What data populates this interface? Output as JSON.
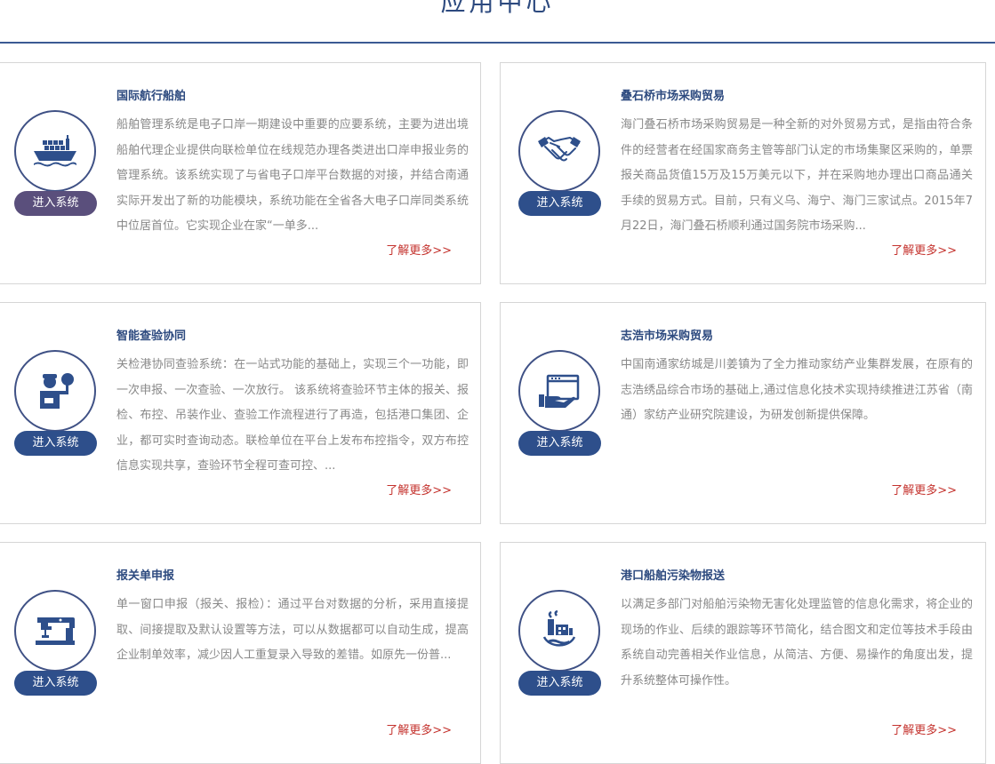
{
  "page": {
    "title": "应用中心"
  },
  "colors": {
    "accent": "#2d4a7f",
    "button_dark": "#5a4f7c",
    "button_blue": "#2e4f8b",
    "more": "#c4322d",
    "text": "#888888"
  },
  "cards": [
    {
      "title": "国际航行船舶",
      "icon": "ship-icon",
      "description": "船舶管理系统是电子口岸一期建设中重要的应要系统，主要为进出境船舶代理企业提供向联检单位在线规范办理各类进出口岸申报业务的管理系统。该系统实现了与省电子口岸平台数据的对接，并结合南通实际开发出了新的功能模块，系统功能在全省各大电子口岸同类系统中位居首位。它实现企业在家“一单多...",
      "button": "进入系统",
      "more": "了解更多>>"
    },
    {
      "title": "叠石桥市场采购贸易",
      "icon": "handshake-icon",
      "description": "海门叠石桥市场采购贸易是一种全新的对外贸易方式，是指由符合条件的经营者在经国家商务主管等部门认定的市场集聚区采购的，单票报关商品货值15万及15万美元以下，并在采购地办理出口商品通关手续的贸易方式。目前，只有义乌、海宁、海门三家试点。2015年7月22日，海门叠石桥顺利通过国务院市场采购...",
      "button": "进入系统",
      "more": "了解更多>>"
    },
    {
      "title": "智能查验协同",
      "icon": "inspector-icon",
      "description": "关检港协同查验系统：在一站式功能的基础上，实现三个一功能，即一次申报、一次查验、一次放行。 该系统将查验环节主体的报关、报检、布控、吊装作业、查验工作流程进行了再造，包括港口集团、企业，都可实时查询动态。联检单位在平台上发布布控指令，双方布控信息实现共享，查验环节全程可查可控、...",
      "button": "进入系统",
      "more": "了解更多>>"
    },
    {
      "title": "志浩市场采购贸易",
      "icon": "web-hand-icon",
      "description": "中国南通家纺城是川姜镇为了全力推动家纺产业集群发展，在原有的志浩绣品综合市场的基础上,通过信息化技术实现持续推进江苏省（南通）家纺产业研究院建设，为研发创新提供保障。",
      "button": "进入系统",
      "more": "了解更多>>"
    },
    {
      "title": "报关单申报",
      "icon": "sewing-machine-icon",
      "description": "单一窗口申报（报关、报检）：通过平台对数据的分析，采用直接提取、间接提取及默认设置等方法，可以从数据都可以自动生成，提高企业制单效率，减少因人工重复录入导致的差错。如原先一份普...",
      "button": "进入系统",
      "more": "了解更多>>"
    },
    {
      "title": "港口船舶污染物报送",
      "icon": "pollution-icon",
      "description": "以满足多部门对船舶污染物无害化处理监管的信息化需求，将企业的现场的作业、后续的跟踪等环节简化，结合图文和定位等技术手段由系统自动完善相关作业信息，从简洁、方便、易操作的角度出发，提升系统整体可操作性。",
      "button": "进入系统",
      "more": "了解更多>>"
    }
  ]
}
